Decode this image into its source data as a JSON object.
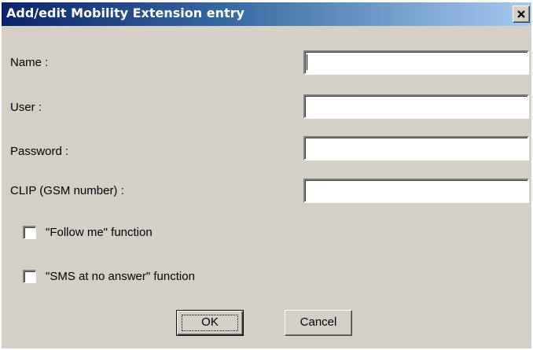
{
  "window": {
    "title": "Add/edit Mobility Extension entry",
    "close_icon": "close-icon",
    "colors": {
      "titlebar_start": "#0a246a",
      "titlebar_end": "#a6caf0",
      "face": "#d4d0c8"
    }
  },
  "form": {
    "name_label": "Name :",
    "name_value": "",
    "user_label": "User :",
    "user_value": "",
    "password_label": "Password :",
    "password_value": "",
    "clip_label": "CLIP (GSM number) :",
    "clip_value": "",
    "follow_me_label": "\"Follow me\" function",
    "follow_me_checked": false,
    "sms_label": "\"SMS at no answer\" function",
    "sms_checked": false
  },
  "buttons": {
    "ok_label": "OK",
    "cancel_label": "Cancel"
  }
}
